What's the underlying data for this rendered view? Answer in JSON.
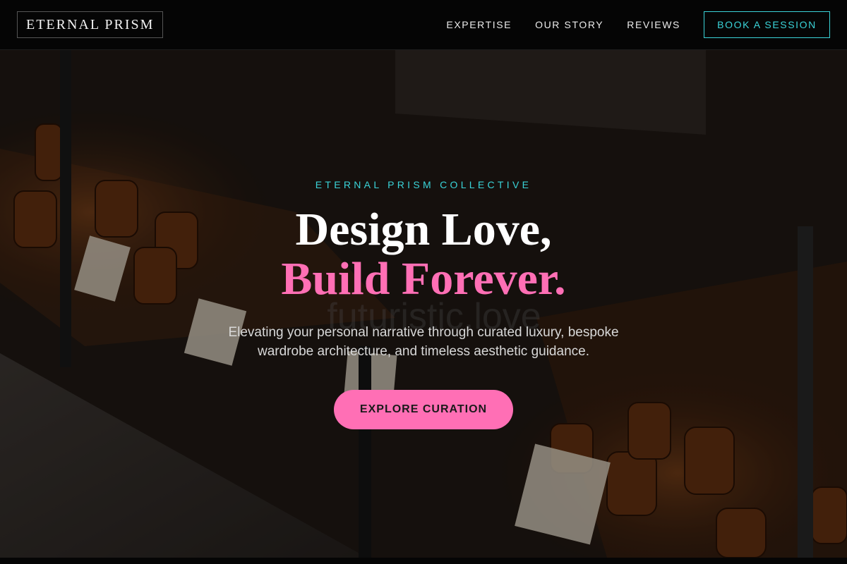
{
  "header": {
    "logo": "ETERNAL PRISM",
    "nav": [
      "EXPERTISE",
      "OUR STORY",
      "REVIEWS"
    ],
    "cta": "BOOK A SESSION"
  },
  "hero": {
    "eyebrow": "ETERNAL PRISM COLLECTIVE",
    "headline_line1": "Design Love,",
    "headline_line2": "Build Forever.",
    "subtext": "Elevating your personal narrative through curated luxury, bespoke wardrobe architecture, and timeless aesthetic guidance.",
    "cta": "EXPLORE CURATION",
    "background_description_icon": "bakery-display-photo"
  },
  "colors": {
    "accent_cyan": "#3ad3d8",
    "accent_pink": "#ff6fb5",
    "header_bg": "#050505"
  }
}
